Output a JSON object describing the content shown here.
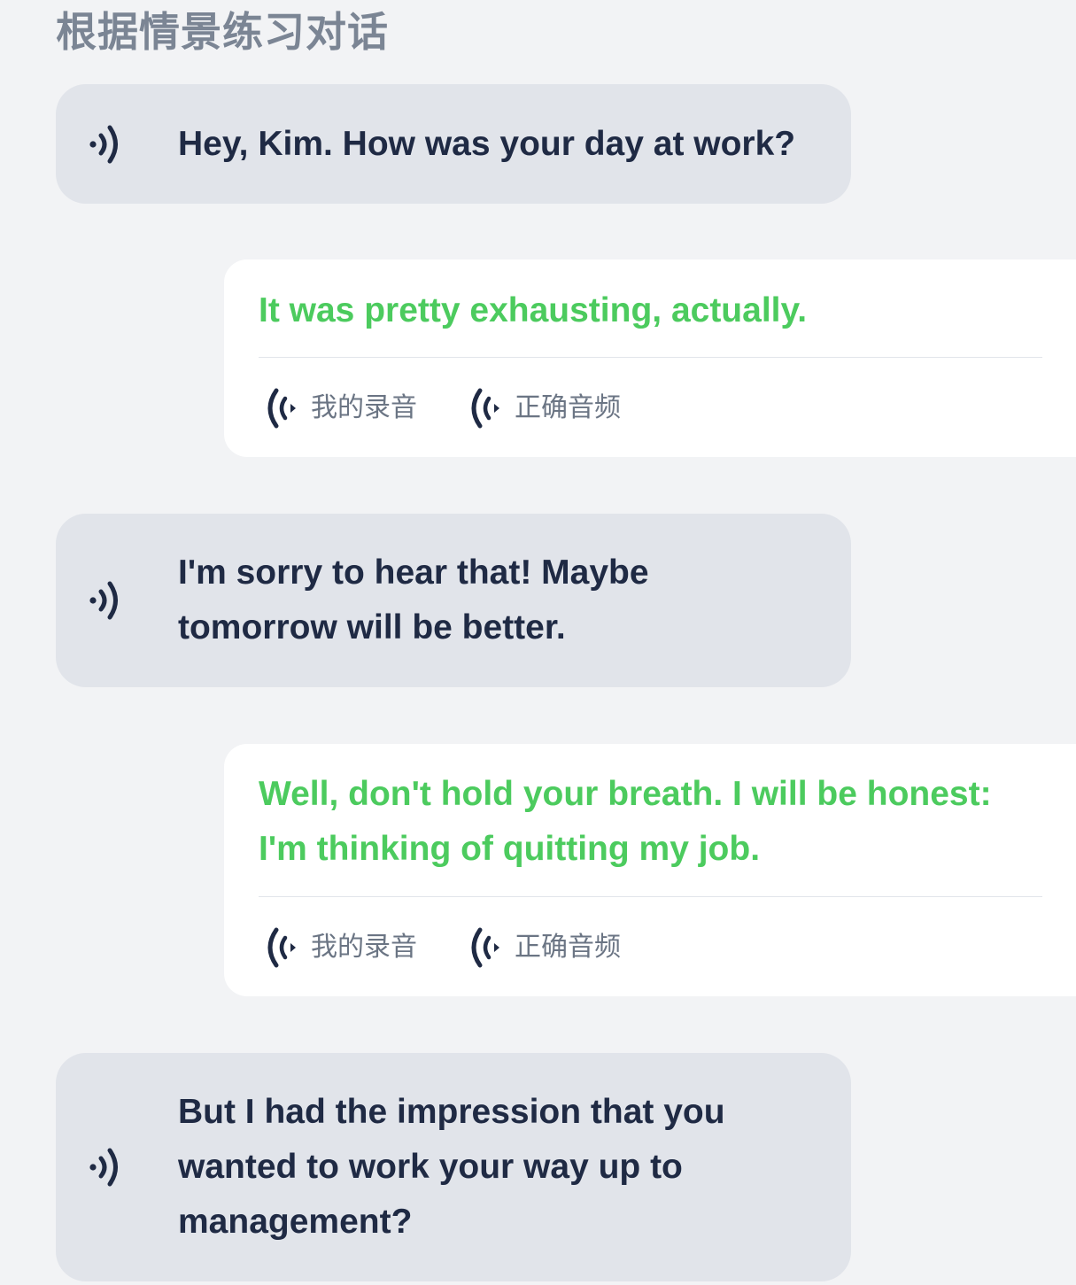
{
  "page": {
    "title": "根据情景练习对话"
  },
  "dialogue": [
    {
      "role": "prompt",
      "text": "Hey, Kim. How was your day at work?"
    },
    {
      "role": "reply",
      "text": "It was pretty exhausting, actually.",
      "my_recording_label": "我的录音",
      "correct_audio_label": "正确音频"
    },
    {
      "role": "prompt",
      "text": "I'm sorry to hear that! Maybe tomorrow will be better."
    },
    {
      "role": "reply",
      "text": "Well, don't hold your breath. I will be honest: I'm thinking of quitting my job.",
      "my_recording_label": "我的录音",
      "correct_audio_label": "正确音频"
    },
    {
      "role": "prompt",
      "text": "But I had the impression that you wanted to work your way up to management?"
    }
  ],
  "colors": {
    "background": "#f2f3f5",
    "prompt_bubble": "#e1e4ea",
    "prompt_text": "#1f2a44",
    "reply_bubble": "#ffffff",
    "reply_text": "#4ccb5e",
    "title_text": "#7b8594",
    "action_label": "#6b7584"
  },
  "icons": {
    "prompt_play": "speaker-play-icon",
    "my_recording": "sound-wave-icon",
    "correct_audio": "sound-wave-icon"
  }
}
